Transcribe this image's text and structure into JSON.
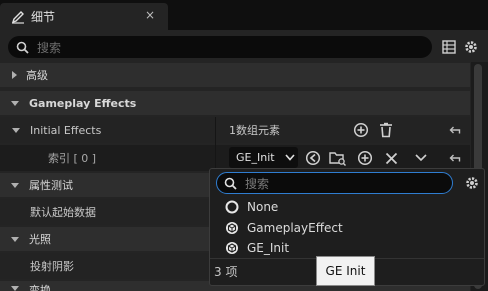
{
  "tab": {
    "title": "细节",
    "close": "×"
  },
  "search": {
    "placeholder": "搜索"
  },
  "rows": {
    "advanced": "高级",
    "gameplay_effects": "Gameplay Effects",
    "initial_effects": "Initial Effects",
    "initial_effects_value": "1数组元素",
    "index": "索引 [ 0 ]",
    "attribute_test": "属性测试",
    "default_start_data": "默认起始数据",
    "lighting": "光照",
    "cast_shadow": "投射阴影",
    "partial": "变换"
  },
  "combo": {
    "value": "GE_Init"
  },
  "dropdown": {
    "search_placeholder": "搜索",
    "items": [
      "None",
      "GameplayEffect",
      "GE_Init"
    ],
    "count": "3 项",
    "tooltip": "GE Init"
  },
  "colors": {
    "accent": "#2f7dd1",
    "panel": "#242424",
    "category": "#2e2e2e"
  }
}
